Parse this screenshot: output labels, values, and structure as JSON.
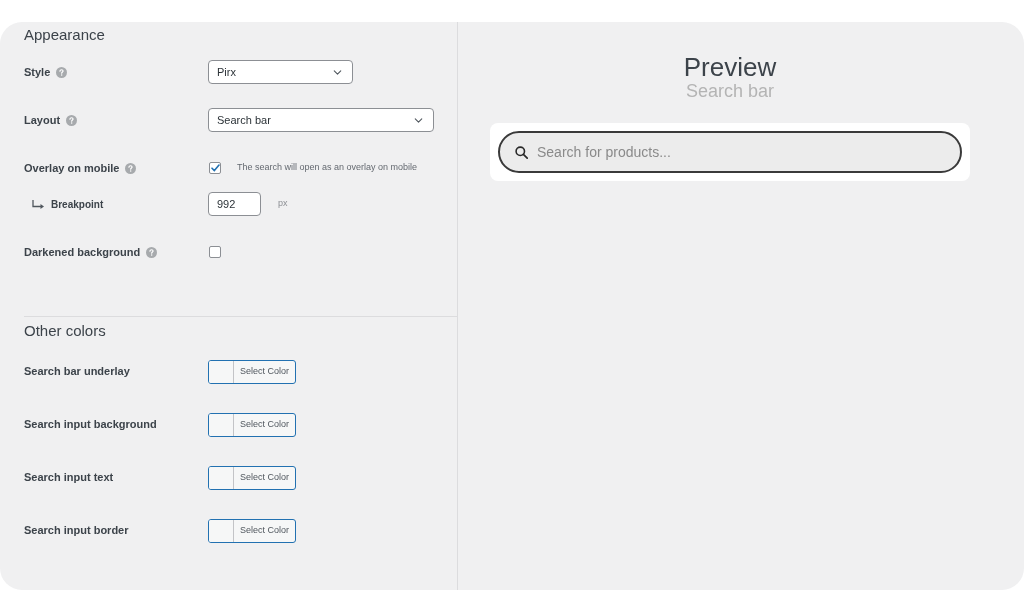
{
  "settings_panel": {
    "sections": [
      {
        "title": "Appearance",
        "rows": [
          {
            "kind": "select",
            "label": "Style",
            "help": true,
            "value": "Pirx"
          },
          {
            "kind": "select",
            "label": "Layout",
            "help": true,
            "value": "Search bar"
          },
          {
            "kind": "checkbox",
            "label": "Overlay on mobile",
            "help": true,
            "checked": true,
            "description": "The search will open as an overlay on mobile",
            "children": [
              {
                "kind": "number",
                "label": "Breakpoint",
                "value": "992",
                "unit": "px"
              }
            ]
          },
          {
            "kind": "checkbox",
            "label": "Darkened background",
            "help": true,
            "checked": false
          }
        ]
      },
      {
        "title": "Other colors",
        "rows": [
          {
            "kind": "color",
            "label": "Search bar underlay",
            "button_label": "Select Color"
          },
          {
            "kind": "color",
            "label": "Search input background",
            "button_label": "Select Color"
          },
          {
            "kind": "color",
            "label": "Search input text",
            "button_label": "Select Color"
          },
          {
            "kind": "color",
            "label": "Search input border",
            "button_label": "Select Color"
          }
        ]
      }
    ]
  },
  "preview": {
    "title": "Preview",
    "subtitle": "Search bar",
    "search": {
      "placeholder": "Search for products..."
    }
  }
}
